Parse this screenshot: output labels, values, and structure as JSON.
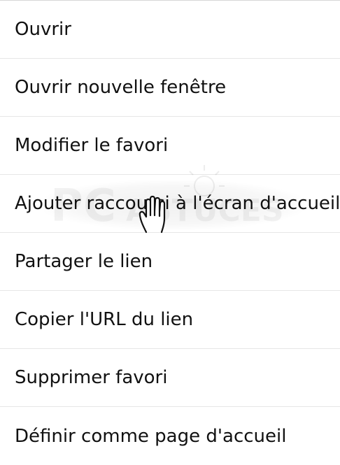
{
  "context_menu": {
    "items": [
      {
        "label": "Ouvrir"
      },
      {
        "label": "Ouvrir nouvelle fenêtre"
      },
      {
        "label": "Modifier le favori"
      },
      {
        "label": "Ajouter raccourci à l'écran d'accueil"
      },
      {
        "label": "Partager le lien"
      },
      {
        "label": "Copier l'URL du lien"
      },
      {
        "label": "Supprimer favori"
      },
      {
        "label": "Définir comme page d'accueil"
      }
    ]
  },
  "overlay": {
    "watermark_logo": "PC ASTUCES",
    "watermark_icon": "lightbulb-icon",
    "pointer_icon": "hand-pointer-icon"
  },
  "colors": {
    "text": "#111111",
    "background": "#ffffff",
    "divider": "#e6e6e6"
  }
}
